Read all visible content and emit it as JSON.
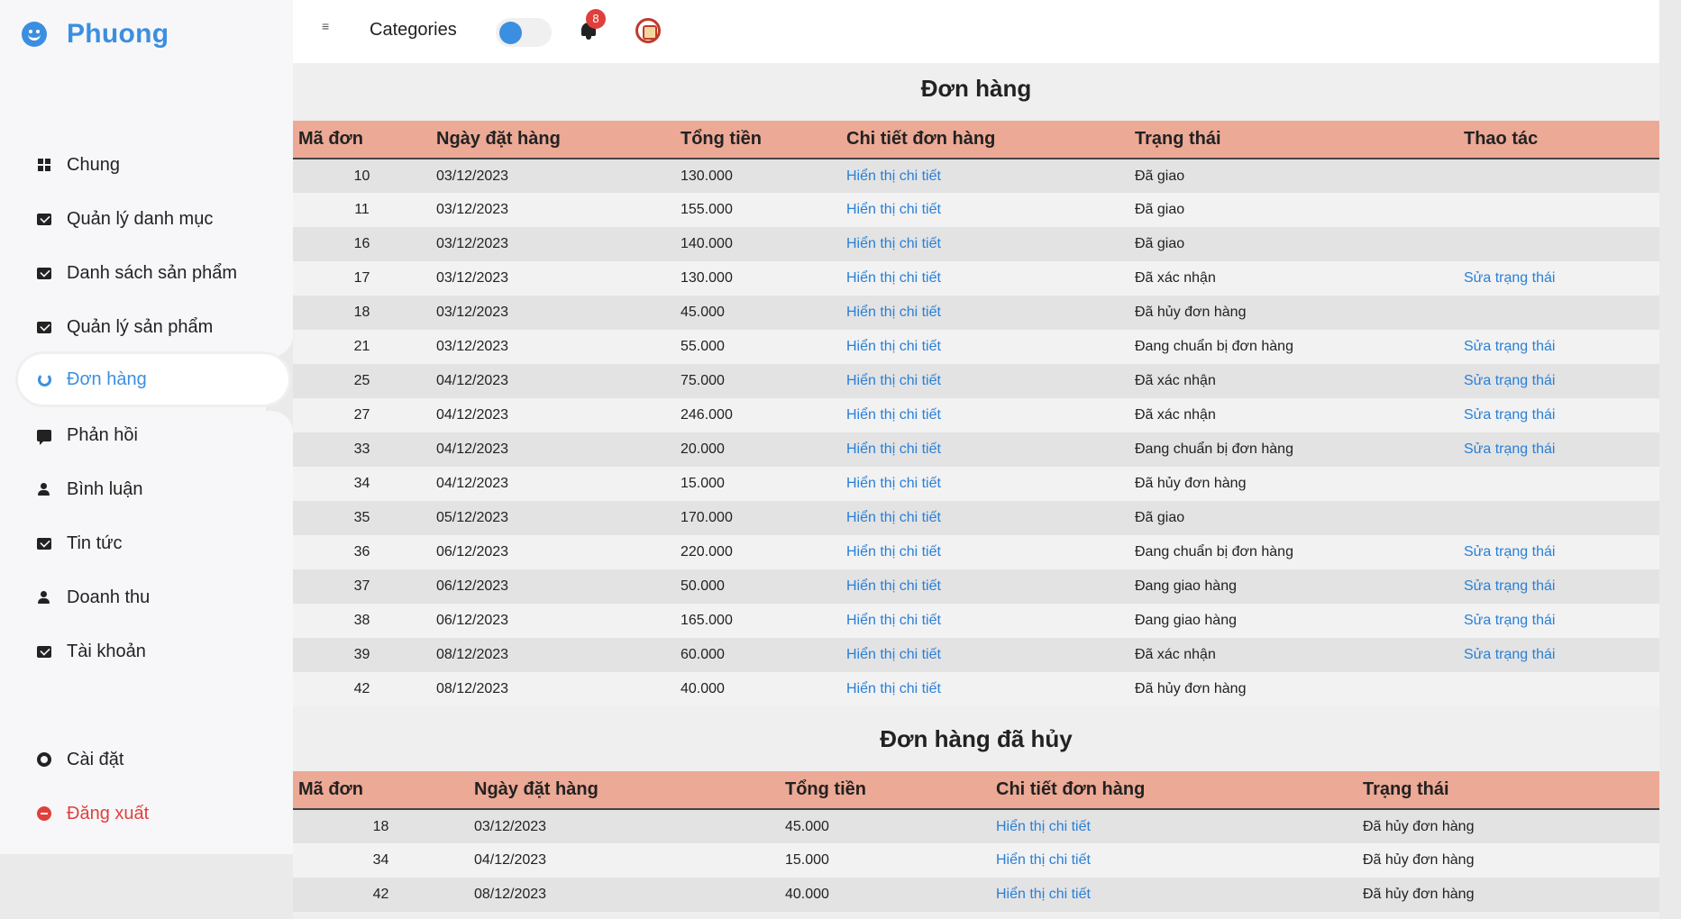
{
  "brand": {
    "name": "Phuong"
  },
  "sidebar": {
    "items": [
      {
        "label": "Chung",
        "icon": "grid-icon"
      },
      {
        "label": "Quản lý danh mục",
        "icon": "mail-icon"
      },
      {
        "label": "Danh sách sản phẩm",
        "icon": "mail-icon"
      },
      {
        "label": "Quản lý sản phẩm",
        "icon": "mail-icon"
      },
      {
        "label": "Đơn hàng",
        "icon": "spinner-icon",
        "active": true
      },
      {
        "label": "Phản hồi",
        "icon": "chat-icon"
      },
      {
        "label": "Bình luận",
        "icon": "user-icon"
      },
      {
        "label": "Tin tức",
        "icon": "mail-icon"
      },
      {
        "label": "Doanh thu",
        "icon": "user-icon"
      },
      {
        "label": "Tài khoản",
        "icon": "mail-icon"
      }
    ],
    "settings_label": "Cài đặt",
    "logout_label": "Đăng xuất"
  },
  "topbar": {
    "menu_glyph": "≡",
    "categories_label": "Categories",
    "notification_count": "8"
  },
  "orders": {
    "title": "Đơn hàng",
    "headers": [
      "Mã đơn",
      "Ngày đặt hàng",
      "Tổng tiền",
      "Chi tiết đơn hàng",
      "Trạng thái",
      "Thao tác"
    ],
    "detail_link": "Hiển thị chi tiết",
    "action_link": "Sửa trạng thái",
    "rows": [
      {
        "id": "10",
        "date": "03/12/2023",
        "total": "130.000",
        "status": "Đã giao",
        "editable": false
      },
      {
        "id": "11",
        "date": "03/12/2023",
        "total": "155.000",
        "status": "Đã giao",
        "editable": false
      },
      {
        "id": "16",
        "date": "03/12/2023",
        "total": "140.000",
        "status": "Đã giao",
        "editable": false
      },
      {
        "id": "17",
        "date": "03/12/2023",
        "total": "130.000",
        "status": "Đã xác nhận",
        "editable": true
      },
      {
        "id": "18",
        "date": "03/12/2023",
        "total": "45.000",
        "status": "Đã hủy đơn hàng",
        "editable": false
      },
      {
        "id": "21",
        "date": "03/12/2023",
        "total": "55.000",
        "status": "Đang chuẩn bị đơn hàng",
        "editable": true
      },
      {
        "id": "25",
        "date": "04/12/2023",
        "total": "75.000",
        "status": "Đã xác nhận",
        "editable": true
      },
      {
        "id": "27",
        "date": "04/12/2023",
        "total": "246.000",
        "status": "Đã xác nhận",
        "editable": true
      },
      {
        "id": "33",
        "date": "04/12/2023",
        "total": "20.000",
        "status": "Đang chuẩn bị đơn hàng",
        "editable": true
      },
      {
        "id": "34",
        "date": "04/12/2023",
        "total": "15.000",
        "status": "Đã hủy đơn hàng",
        "editable": false
      },
      {
        "id": "35",
        "date": "05/12/2023",
        "total": "170.000",
        "status": "Đã giao",
        "editable": false
      },
      {
        "id": "36",
        "date": "06/12/2023",
        "total": "220.000",
        "status": "Đang chuẩn bị đơn hàng",
        "editable": true
      },
      {
        "id": "37",
        "date": "06/12/2023",
        "total": "50.000",
        "status": "Đang giao hàng",
        "editable": true
      },
      {
        "id": "38",
        "date": "06/12/2023",
        "total": "165.000",
        "status": "Đang giao hàng",
        "editable": true
      },
      {
        "id": "39",
        "date": "08/12/2023",
        "total": "60.000",
        "status": "Đã xác nhận",
        "editable": true
      },
      {
        "id": "42",
        "date": "08/12/2023",
        "total": "40.000",
        "status": "Đã hủy đơn hàng",
        "editable": false
      }
    ]
  },
  "cancelled": {
    "title": "Đơn hàng đã hủy",
    "headers": [
      "Mã đơn",
      "Ngày đặt hàng",
      "Tổng tiền",
      "Chi tiết đơn hàng",
      "Trạng thái"
    ],
    "detail_link": "Hiển thị chi tiết",
    "rows": [
      {
        "id": "18",
        "date": "03/12/2023",
        "total": "45.000",
        "status": "Đã hủy đơn hàng"
      },
      {
        "id": "34",
        "date": "04/12/2023",
        "total": "15.000",
        "status": "Đã hủy đơn hàng"
      },
      {
        "id": "42",
        "date": "08/12/2023",
        "total": "40.000",
        "status": "Đã hủy đơn hàng"
      }
    ]
  },
  "colors": {
    "accent": "#3b8fe0",
    "header_bg": "#eca995",
    "link": "#2a7fd6",
    "danger": "#e0403c"
  }
}
